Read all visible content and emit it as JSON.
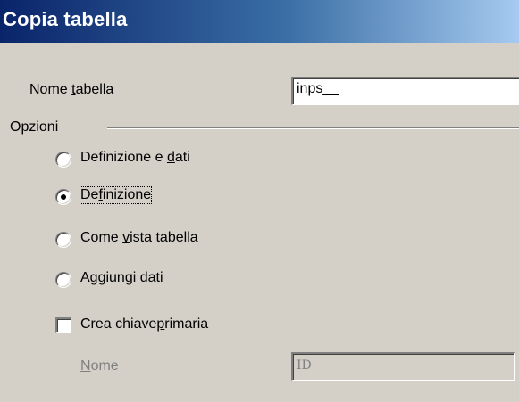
{
  "dialog": {
    "title": "Copia tabella",
    "table_name": {
      "label_pre": "Nome ",
      "label_mnemonic": "t",
      "label_post": "abella",
      "value": "inps__"
    },
    "options_group": {
      "label": "Opzioni"
    },
    "options": [
      {
        "pre": "Definizione e ",
        "mnemonic": "d",
        "post": "ati",
        "selected": false
      },
      {
        "pre": "De",
        "mnemonic": "f",
        "post": "inizione",
        "selected": true
      },
      {
        "pre": "Come ",
        "mnemonic": "v",
        "post": "ista tabella",
        "selected": false
      },
      {
        "pre": "Aggiungi ",
        "mnemonic": "d",
        "post": "ati",
        "selected": false
      }
    ],
    "primary_key": {
      "pre": "Crea chiave",
      "mnemonic": "p",
      "post": "rimaria",
      "checked": false
    },
    "key_name": {
      "label_mnemonic": "N",
      "label_post": "ome",
      "value": "ID",
      "enabled": false
    }
  }
}
